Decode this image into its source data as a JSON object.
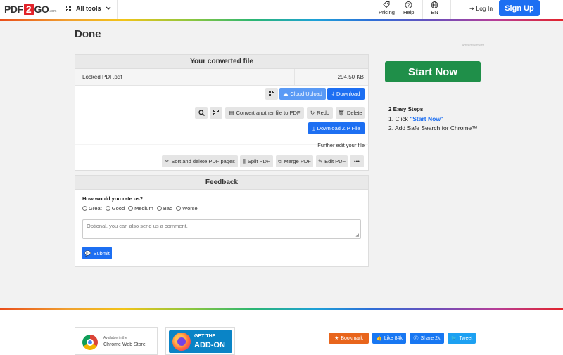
{
  "header": {
    "logo": {
      "pre": "PDF",
      "two": "2",
      "post": "GO",
      "suffix": ".com"
    },
    "all_tools": "All tools",
    "pricing": "Pricing",
    "help": "Help",
    "language": "EN",
    "login": "Log In",
    "signup": "Sign Up"
  },
  "page": {
    "title": "Done",
    "ad_label": "Advertisement"
  },
  "converted": {
    "heading": "Your converted file",
    "file_name": "Locked PDF.pdf",
    "file_size": "294.50 KB",
    "cloud_upload": "Cloud Upload",
    "download": "Download",
    "convert_another": "Convert another file to PDF",
    "redo": "Redo",
    "delete": "Delete",
    "download_zip": "Download ZIP File",
    "further_edit": "Further edit your file",
    "tools": {
      "sort_delete": "Sort and delete PDF pages",
      "split": "Split PDF",
      "merge": "Merge PDF",
      "edit": "Edit PDF",
      "more": "•••"
    }
  },
  "feedback": {
    "heading": "Feedback",
    "question": "How would you rate us?",
    "options": [
      "Great",
      "Good",
      "Medium",
      "Bad",
      "Worse"
    ],
    "comment_placeholder": "Optional, you can also send us a comment.",
    "submit": "Submit"
  },
  "side": {
    "start_now": "Start Now",
    "steps_title": "2 Easy Steps",
    "step1_prefix": "1. Click ",
    "step1_link": "\"Start Now\"",
    "step2": "2. Add Safe Search for Chrome™"
  },
  "footer": {
    "chrome_small": "Available in the",
    "chrome_big": "Chrome Web Store",
    "addon_small": "GET THE",
    "addon_big": "ADD-ON",
    "bookmark": "Bookmark",
    "like": "Like 84k",
    "share": "Share 2k",
    "tweet": "Tweet"
  },
  "colors": {
    "primary": "#1d6ff2",
    "start_green": "#1f8f49",
    "bookmark_orange": "#e8651c",
    "facebook_blue": "#1877f2",
    "twitter_blue": "#1da1f2"
  }
}
